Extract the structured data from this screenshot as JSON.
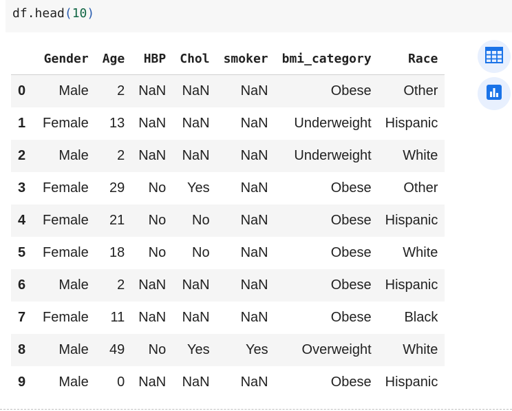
{
  "code_cell": {
    "object": "df",
    "dot_method": ".head",
    "open_paren": "(",
    "arg": "10",
    "close_paren": ")"
  },
  "table": {
    "columns": [
      "Gender",
      "Age",
      "HBP",
      "Chol",
      "smoker",
      "bmi_category",
      "Race"
    ],
    "rows": [
      {
        "index": "0",
        "cells": [
          "Male",
          "2",
          "NaN",
          "NaN",
          "NaN",
          "Obese",
          "Other"
        ]
      },
      {
        "index": "1",
        "cells": [
          "Female",
          "13",
          "NaN",
          "NaN",
          "NaN",
          "Underweight",
          "Hispanic"
        ]
      },
      {
        "index": "2",
        "cells": [
          "Male",
          "2",
          "NaN",
          "NaN",
          "NaN",
          "Underweight",
          "White"
        ]
      },
      {
        "index": "3",
        "cells": [
          "Female",
          "29",
          "No",
          "Yes",
          "NaN",
          "Obese",
          "Other"
        ]
      },
      {
        "index": "4",
        "cells": [
          "Female",
          "21",
          "No",
          "No",
          "NaN",
          "Obese",
          "Hispanic"
        ]
      },
      {
        "index": "5",
        "cells": [
          "Female",
          "18",
          "No",
          "No",
          "NaN",
          "Obese",
          "White"
        ]
      },
      {
        "index": "6",
        "cells": [
          "Male",
          "2",
          "NaN",
          "NaN",
          "NaN",
          "Obese",
          "Hispanic"
        ]
      },
      {
        "index": "7",
        "cells": [
          "Female",
          "11",
          "NaN",
          "NaN",
          "NaN",
          "Obese",
          "Black"
        ]
      },
      {
        "index": "8",
        "cells": [
          "Male",
          "49",
          "No",
          "Yes",
          "Yes",
          "Overweight",
          "White"
        ]
      },
      {
        "index": "9",
        "cells": [
          "Male",
          "0",
          "NaN",
          "NaN",
          "NaN",
          "Obese",
          "Hispanic"
        ]
      }
    ]
  },
  "side_buttons": [
    {
      "icon": "table-grid-icon"
    },
    {
      "icon": "bar-chart-icon"
    }
  ],
  "colors": {
    "accent": "#1a73e8",
    "button_bg": "#e8f0fe",
    "stripe": "#f5f5f5",
    "code_bg": "#f7f7f7"
  }
}
